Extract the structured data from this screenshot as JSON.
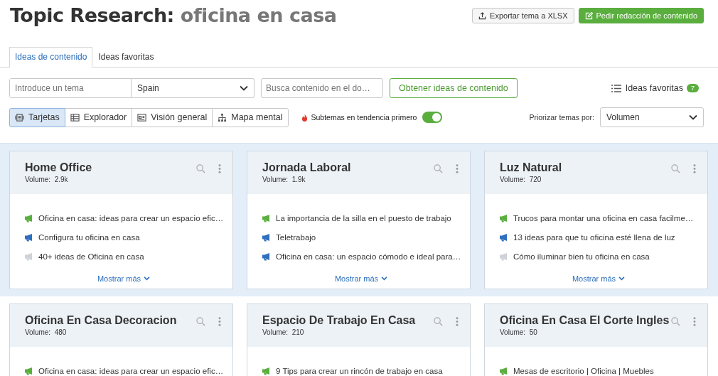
{
  "header": {
    "title": "Topic Research:",
    "topic": "oficina en casa",
    "buttons": [
      {
        "label": "Exportar tema a XLSX",
        "kind": "export"
      },
      {
        "label": "Pedir redacción de contenido",
        "kind": "order"
      }
    ]
  },
  "tabs": [
    {
      "label": "Ideas de contenido",
      "selected": true
    },
    {
      "label": "Ideas favoritas",
      "selected": false
    }
  ],
  "search": {
    "topic_placeholder": "Introduce un tema",
    "country": "Spain",
    "domain_placeholder": "Busca contenido en el do…",
    "submit": "Obtener ideas de contenido",
    "favorites": "Ideas favoritas",
    "favorites_count": "7"
  },
  "views": [
    {
      "label": "Tarjetas",
      "kind": "cards",
      "selected": true
    },
    {
      "label": "Explorador",
      "kind": "table",
      "selected": false
    },
    {
      "label": "Visión general",
      "kind": "overview",
      "selected": false
    },
    {
      "label": "Mapa mental",
      "kind": "mindmap",
      "selected": false
    }
  ],
  "trending": {
    "label": "Subtemas en tendencia primero",
    "on": true
  },
  "sort": {
    "label": "Priorizar temas por:",
    "value": "Volumen"
  },
  "rows": [
    {
      "selected": true,
      "cards": [
        {
          "title": "Home Office",
          "volume_label": "Volume:",
          "volume": "2.9k",
          "ideas": [
            {
              "text": "Oficina en casa: ideas para crear un espacio efic…",
              "color": "#5aae3e"
            },
            {
              "text": "Configura tu oficina en casa",
              "color": "#2f6fbf"
            },
            {
              "text": "40+ ideas de Oficina en casa",
              "color": "#cfd2d6"
            }
          ],
          "more": "Mostrar más"
        },
        {
          "title": "Jornada Laboral",
          "volume_label": "Volume:",
          "volume": "1.9k",
          "ideas": [
            {
              "text": "La importancia de la silla en el puesto de trabajo",
              "color": "#5aae3e"
            },
            {
              "text": "Teletrabajo",
              "color": "#2f6fbf"
            },
            {
              "text": "Oficina en casa: un espacio cómodo e ideal para…",
              "color": "#2f6fbf"
            }
          ],
          "more": "Mostrar más"
        },
        {
          "title": "Luz Natural",
          "volume_label": "Volume:",
          "volume": "720",
          "ideas": [
            {
              "text": "Trucos para montar una oficina en casa facilme…",
              "color": "#5aae3e"
            },
            {
              "text": "13 ideas para que tu oficina esté llena de luz",
              "color": "#2f6fbf"
            },
            {
              "text": "Cómo iluminar bien tu oficina en casa",
              "color": "#cfd2d6"
            }
          ],
          "more": "Mostrar más"
        }
      ]
    },
    {
      "selected": false,
      "cards": [
        {
          "title": "Oficina En Casa Decoracion",
          "volume_label": "Volume:",
          "volume": "480",
          "ideas": [
            {
              "text": "Oficina en casa: ideas para crear un espacio efic…",
              "color": "#5aae3e"
            }
          ]
        },
        {
          "title": "Espacio De Trabajo En Casa",
          "volume_label": "Volume:",
          "volume": "210",
          "ideas": [
            {
              "text": "9 Tips para crear un rincón de trabajo en casa",
              "color": "#5aae3e"
            }
          ]
        },
        {
          "title": "Oficina En Casa El Corte Ingles",
          "volume_label": "Volume:",
          "volume": "50",
          "ideas": [
            {
              "text": "Mesas de escritorio | Oficina | Muebles",
              "color": "#5aae3e"
            }
          ]
        }
      ]
    }
  ]
}
